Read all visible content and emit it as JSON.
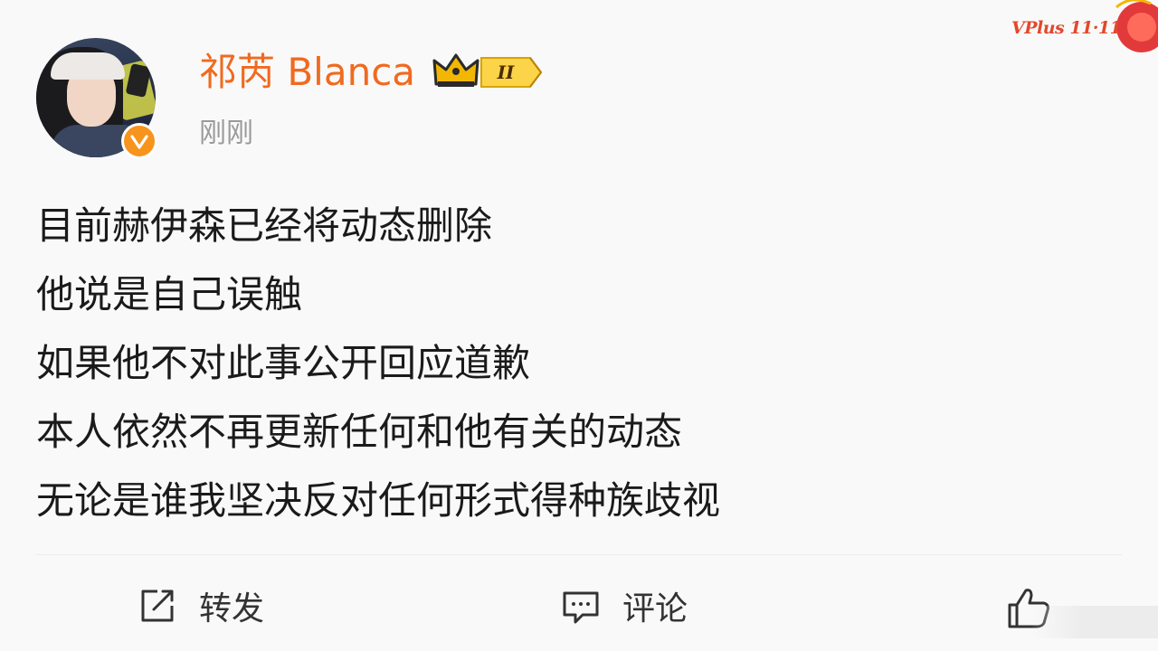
{
  "user": {
    "name": "祁芮 Blanca",
    "level_badge": "II"
  },
  "post": {
    "timestamp": "刚刚",
    "lines": [
      "目前赫伊森已经将动态删除",
      "他说是自己误触",
      "如果他不对此事公开回应道歉",
      "本人依然不再更新任何和他有关的动态",
      "无论是谁我坚决反对任何形式得种族歧视"
    ]
  },
  "promo": {
    "text": "VPlus 11·11"
  },
  "actions": {
    "repost_label": "转发",
    "comment_label": "评论"
  },
  "colors": {
    "username": "#f06a1f",
    "verified": "#f7941d",
    "crown": "#f2b705",
    "promo": "#e2482c"
  },
  "icons": {
    "verified": "verified-badge-icon",
    "crown": "crown-icon",
    "repost": "share-icon",
    "comment": "comment-icon",
    "like": "thumbs-up-icon"
  }
}
